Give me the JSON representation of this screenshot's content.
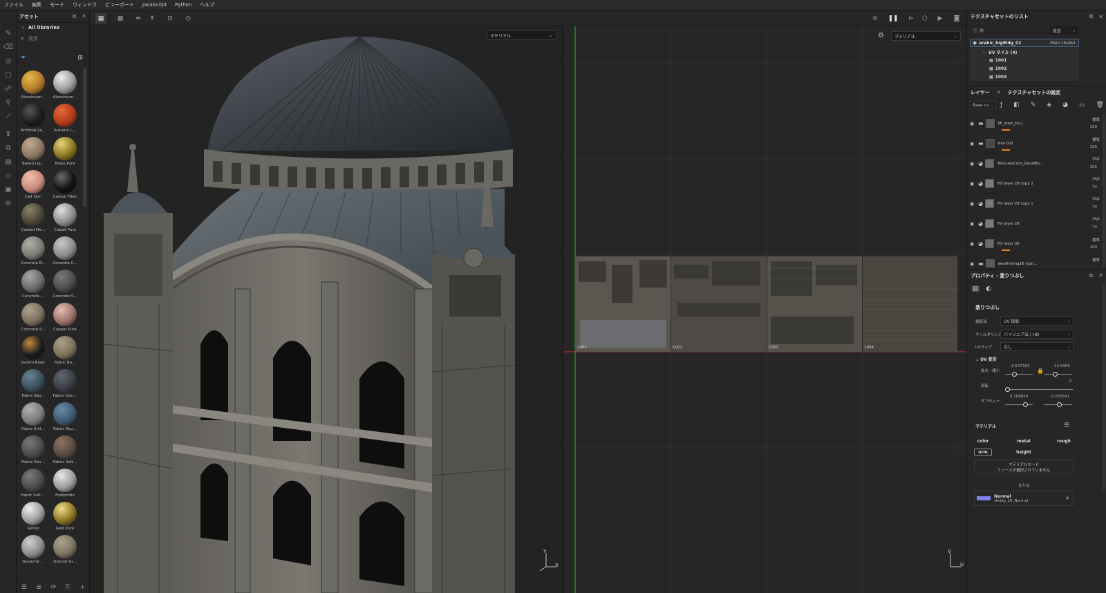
{
  "menu": [
    "ファイル",
    "編集",
    "モード",
    "ウィンドウ",
    "ビューポート",
    "JavaScript",
    "Python",
    "ヘルプ"
  ],
  "assets": {
    "title": "アセット",
    "library": "All libraries",
    "search_placeholder": "検索",
    "materials": [
      {
        "name": "Aluminium...",
        "color": "#b07a2a",
        "hl": "#e8b84a"
      },
      {
        "name": "Aluminium...",
        "color": "#9a9a9a",
        "hl": "#eeeeee"
      },
      {
        "name": "Artificial Le...",
        "color": "#1a1a1a",
        "hl": "#555555"
      },
      {
        "name": "Autumn L...",
        "color": "#b03a1a",
        "hl": "#e66a3a"
      },
      {
        "name": "Baked Lig...",
        "color": "#8a7660",
        "hl": "#c0ab92"
      },
      {
        "name": "Brass Pure",
        "color": "#8a7420",
        "hl": "#e6d27a"
      },
      {
        "name": "Calf Skin",
        "color": "#c88a7a",
        "hl": "#f0c0b0"
      },
      {
        "name": "Carbon Fiber",
        "color": "#111111",
        "hl": "#6a6a6a"
      },
      {
        "name": "Coated Me...",
        "color": "#4a4434",
        "hl": "#8a8268"
      },
      {
        "name": "Cobalt Pure",
        "color": "#8a8a8a",
        "hl": "#e0e0e0"
      },
      {
        "name": "Concrete B...",
        "color": "#7a7a72",
        "hl": "#b0b0a8"
      },
      {
        "name": "Concrete C...",
        "color": "#8a8a8a",
        "hl": "#c8c8c8"
      },
      {
        "name": "Concrete ...",
        "color": "#6a6a6a",
        "hl": "#a8a8a8"
      },
      {
        "name": "Concrete S...",
        "color": "#4a4a4a",
        "hl": "#7a7a7a"
      },
      {
        "name": "Concrete S...",
        "color": "#7a6e5c",
        "hl": "#b0a490"
      },
      {
        "name": "Copper Pure",
        "color": "#9a7068",
        "hl": "#e4beb4"
      },
      {
        "name": "Denim Rivet",
        "color": "#1a1a1a",
        "hl": "#c08a40"
      },
      {
        "name": "Fabric Ba...",
        "color": "#7a7058",
        "hl": "#aca288"
      },
      {
        "name": "Fabric Bas...",
        "color": "#3a4e5a",
        "hl": "#6a8494"
      },
      {
        "name": "Fabric Den...",
        "color": "#3a3e44",
        "hl": "#60666e"
      },
      {
        "name": "Fabric Knit...",
        "color": "#7a7a7a",
        "hl": "#b0b0b0"
      },
      {
        "name": "Fabric Rou...",
        "color": "#3e5a72",
        "hl": "#6a8aa6"
      },
      {
        "name": "Fabric Rou...",
        "color": "#4a4a4a",
        "hl": "#787878"
      },
      {
        "name": "Fabric Soft...",
        "color": "#5a4a40",
        "hl": "#8a7464"
      },
      {
        "name": "Fabric Suit ...",
        "color": "#4a4a4a",
        "hl": "#7a7a7a"
      },
      {
        "name": "Footprints",
        "color": "#9a9a9a",
        "hl": "#e8e8e8"
      },
      {
        "name": "Glitter",
        "color": "#9a9a9a",
        "hl": "#f0f0f0"
      },
      {
        "name": "Gold Pure",
        "color": "#8a7420",
        "hl": "#f0dc8a"
      },
      {
        "name": "Gouache ...",
        "color": "#8a8a8a",
        "hl": "#d0d0d0"
      },
      {
        "name": "Ground Gr...",
        "color": "#7a7260",
        "hl": "#aea490"
      }
    ]
  },
  "viewport3d": {
    "dropdown": "マテリアル",
    "gizmo_y": "Y",
    "gizmo_x": "X"
  },
  "viewportUV": {
    "dropdown": "マテリアル",
    "tiles": [
      "1001",
      "1002",
      "1003",
      "1004"
    ],
    "gizmo_v": "V",
    "gizmo_u": "U"
  },
  "textureSetList": {
    "title": "テクスチャセットのリスト",
    "settings": "設定",
    "set_name": "arabic_bigBldg_02",
    "shader": "Main shader",
    "uv_tiles_label": "UV タイル (4)",
    "uv_tiles": [
      "1001",
      "1002",
      "1003"
    ]
  },
  "layers": {
    "tab_layers": "レイヤー",
    "tab_settings": "テクスチャセットの設定",
    "channel": "Base co",
    "items": [
      {
        "name": "IIF_steel_bru...",
        "blend": "標準",
        "opacity": "100",
        "thumb": "#5a5a5a"
      },
      {
        "name": "Iron Old",
        "blend": "標準",
        "opacity": "100",
        "thumb": "#4a4a4a"
      },
      {
        "name": "TexturesCom_DecalBo...",
        "blend": "Slgt",
        "opacity": "100",
        "thumb": "#6a6a6a"
      },
      {
        "name": "Fill layer 28 copy 2",
        "blend": "Slgt",
        "opacity": "74",
        "thumb": "#7a7a7a"
      },
      {
        "name": "Fill layer 28 copy 1",
        "blend": "Slgt",
        "opacity": "74",
        "thumb": "#7a7a7a"
      },
      {
        "name": "Fill layer 28",
        "blend": "Slgt",
        "opacity": "74",
        "thumb": "#7a7a7a"
      },
      {
        "name": "Fill layer 30",
        "blend": "標準",
        "opacity": "100",
        "thumb": "#6a6a6a"
      },
      {
        "name": "weathering16 (con...",
        "blend": "標準",
        "opacity": "",
        "thumb": "#5a5a5a"
      }
    ]
  },
  "properties": {
    "title": "プロパティ - 塗りつぶし",
    "section": "塗りつぶし",
    "projection_label": "投影法",
    "projection_value": "UV 投影",
    "filter_label": "フィルタリング",
    "filter_value": "バイリニア法 | HQ",
    "wrap_label": "UVラップ",
    "wrap_value": "なし",
    "uv_transform": "UV 変形",
    "scale_label": "拡大・縮小",
    "scale_u": "-3.547393",
    "scale_v": "-13.0405",
    "rotation_label": "回転",
    "rotation_value": "0",
    "offset_label": "オフセット",
    "offset_u": "0.788824",
    "offset_v": "-0.070591",
    "material_label": "マテリアル",
    "channels": [
      "color",
      "metal",
      "rough",
      "nrm",
      "height"
    ],
    "material_mode": "マテリアルモード",
    "no_resource": "リソースが選択されていません",
    "or": "または",
    "normal_title": "Normal",
    "normal_file": "stkblg_2K_Normal"
  }
}
